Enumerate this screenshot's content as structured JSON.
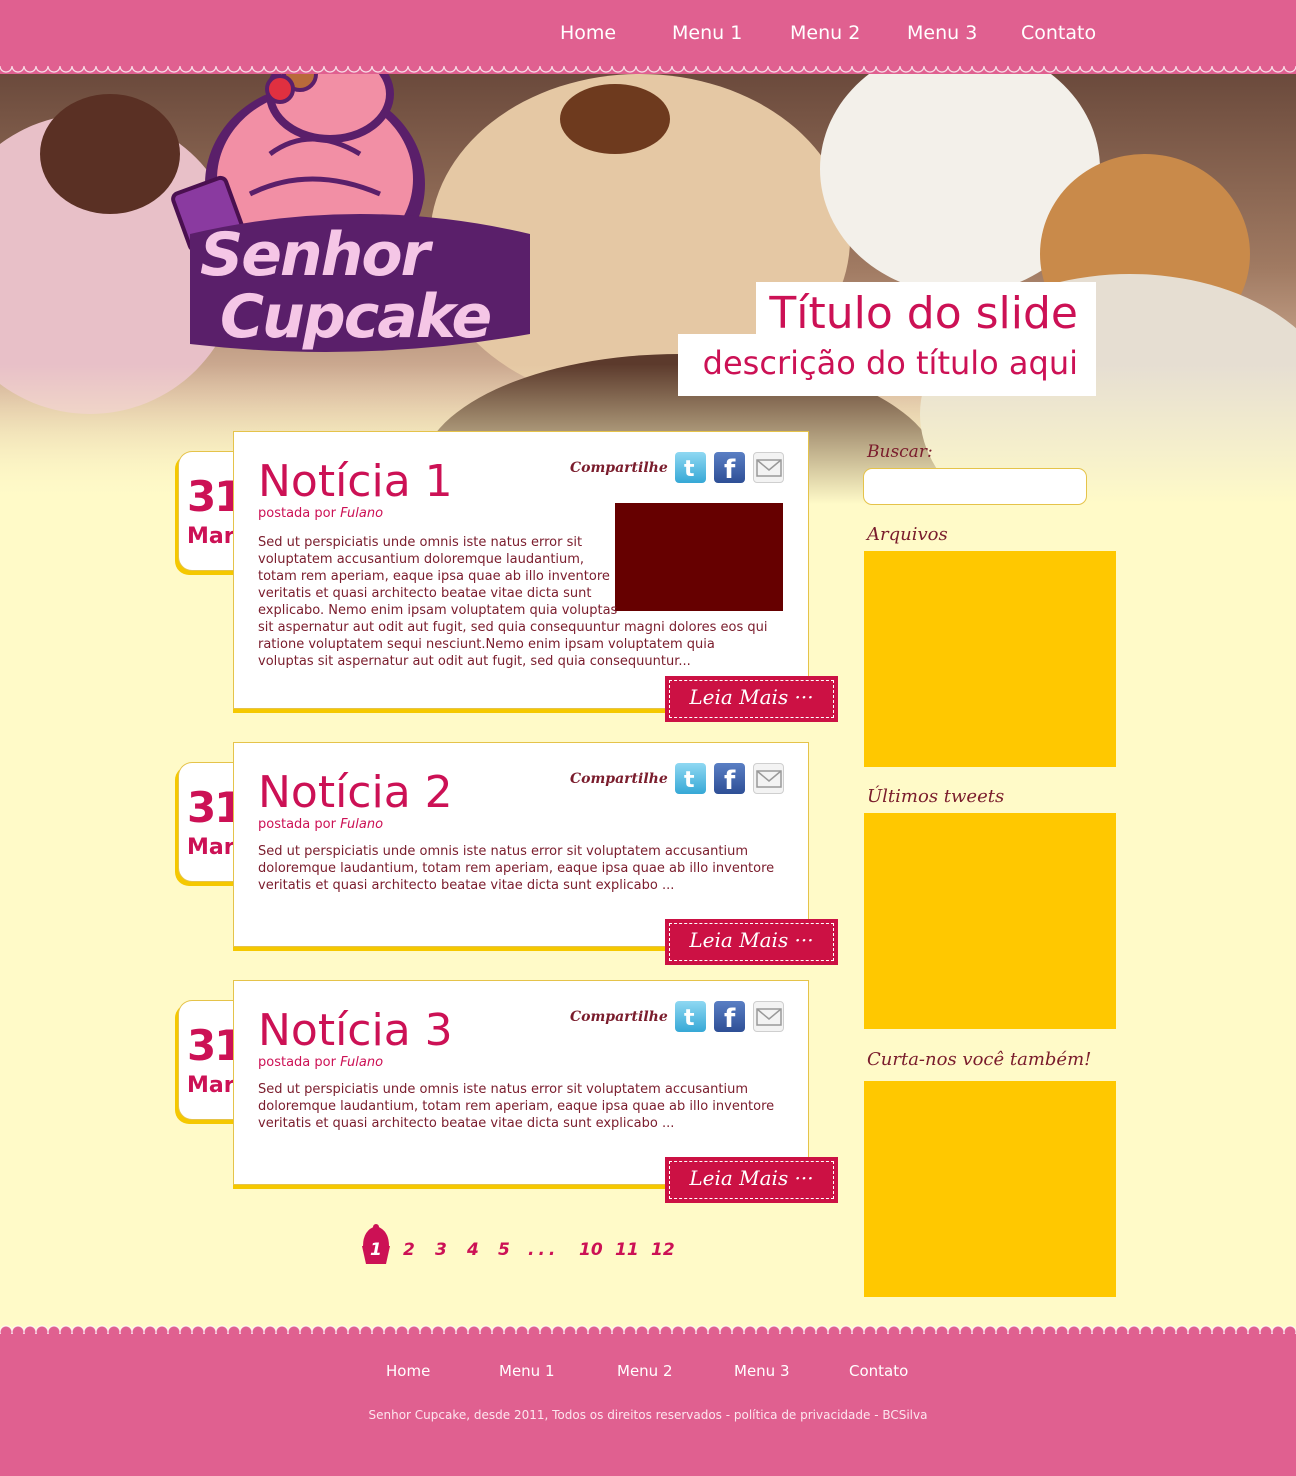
{
  "nav": {
    "items": [
      "Home",
      "Menu 1",
      "Menu 2",
      "Menu 3",
      "Contato"
    ]
  },
  "logo": {
    "line1": "Senhor",
    "line2": "Cupcake"
  },
  "slide": {
    "title": "Título do slide",
    "description": "descrição do título aqui"
  },
  "posts": [
    {
      "day": "31",
      "month": "Mar",
      "title": "Notícia 1",
      "by_label": "postada por",
      "author": "Fulano",
      "share_label": "Compartilhe",
      "body_lines": [
        "Sed ut perspiciatis unde omnis iste natus error sit",
        "voluptatem accusantium doloremque laudantium,",
        "totam rem aperiam, eaque ipsa quae ab illo inventore",
        "veritatis et quasi architecto beatae vitae dicta sunt",
        "explicabo. Nemo enim ipsam voluptatem quia voluptas",
        "sit aspernatur aut odit aut fugit, sed quia consequuntur magni dolores eos qui",
        "ratione voluptatem sequi nesciunt.Nemo enim ipsam voluptatem quia",
        "voluptas sit aspernatur aut odit aut fugit, sed quia consequuntur..."
      ],
      "read_more": "Leia Mais ···"
    },
    {
      "day": "31",
      "month": "Mar",
      "title": "Notícia 2",
      "by_label": "postada por",
      "author": "Fulano",
      "share_label": "Compartilhe",
      "body_lines": [
        "Sed ut perspiciatis unde omnis iste natus error sit voluptatem accusantium",
        "doloremque laudantium, totam rem aperiam, eaque ipsa quae ab illo inventore",
        "veritatis et quasi architecto beatae vitae dicta sunt explicabo ..."
      ],
      "read_more": "Leia Mais ···"
    },
    {
      "day": "31",
      "month": "Mar",
      "title": "Notícia 3",
      "by_label": "postada por",
      "author": "Fulano",
      "share_label": "Compartilhe",
      "body_lines": [
        "Sed ut perspiciatis unde omnis iste natus error sit voluptatem accusantium",
        "doloremque laudantium, totam rem aperiam, eaque ipsa quae ab illo inventore",
        "veritatis et quasi architecto beatae vitae dicta sunt explicabo ..."
      ],
      "read_more": "Leia Mais ···"
    }
  ],
  "pagination": {
    "current": "1",
    "pages": [
      "2",
      "3",
      "4",
      "5",
      "...",
      "10",
      "11",
      "12"
    ]
  },
  "sidebar": {
    "search_label": "Buscar:",
    "archives_label": "Arquivos",
    "tweets_label": "Últimos tweets",
    "like_label": "Curta-nos você também!"
  },
  "footer": {
    "nav": [
      "Home",
      "Menu 1",
      "Menu 2",
      "Menu 3",
      "Contato"
    ],
    "copyright": "Senhor Cupcake, desde 2011, Todos os direitos reservados - política de privacidade - BCSilva"
  },
  "colors": {
    "brand_pink": "#e06090",
    "accent_red": "#cc1155",
    "cream": "#fffac8",
    "widget_yellow": "#ffc800",
    "image_placeholder": "#660000"
  },
  "icons": [
    "twitter-icon",
    "facebook-icon",
    "mail-icon",
    "cupcake-icon"
  ]
}
